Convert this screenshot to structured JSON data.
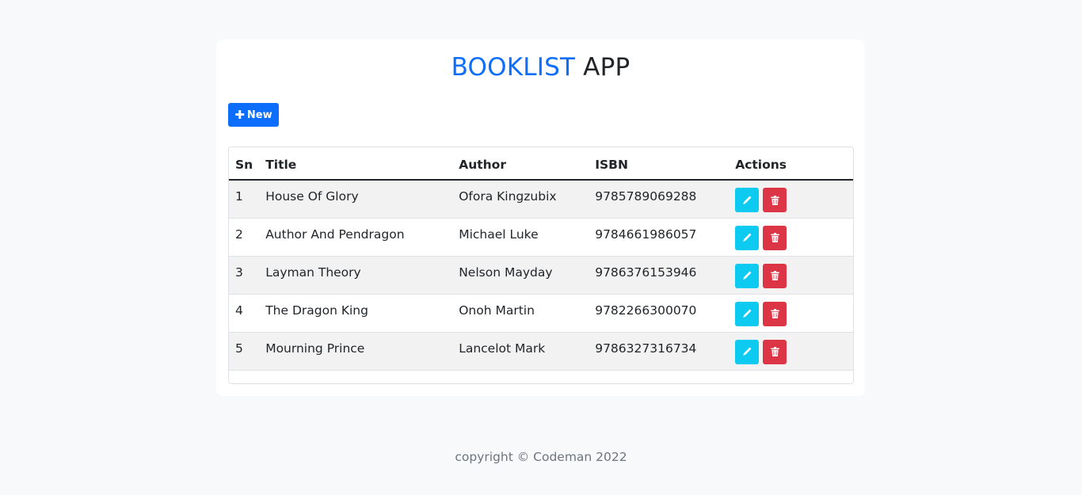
{
  "header": {
    "title_accent": "BOOKLIST",
    "title_rest": "APP"
  },
  "toolbar": {
    "new_label": "New"
  },
  "table": {
    "columns": [
      "Sn",
      "Title",
      "Author",
      "ISBN",
      "Actions"
    ],
    "rows": [
      {
        "sn": "1",
        "title": "House Of Glory",
        "author": "Ofora Kingzubix",
        "isbn": "9785789069288"
      },
      {
        "sn": "2",
        "title": "Author And Pendragon",
        "author": "Michael Luke",
        "isbn": "9784661986057"
      },
      {
        "sn": "3",
        "title": "Layman Theory",
        "author": "Nelson Mayday",
        "isbn": "9786376153946"
      },
      {
        "sn": "4",
        "title": "The Dragon King",
        "author": "Onoh Martin",
        "isbn": "9782266300070"
      },
      {
        "sn": "5",
        "title": "Mourning Prince",
        "author": "Lancelot Mark",
        "isbn": "9786327316734"
      }
    ]
  },
  "footer": {
    "text": "copyright © Codeman 2022"
  },
  "colors": {
    "primary": "#0d6efd",
    "edit": "#0dcaf0",
    "delete": "#dc3545"
  }
}
